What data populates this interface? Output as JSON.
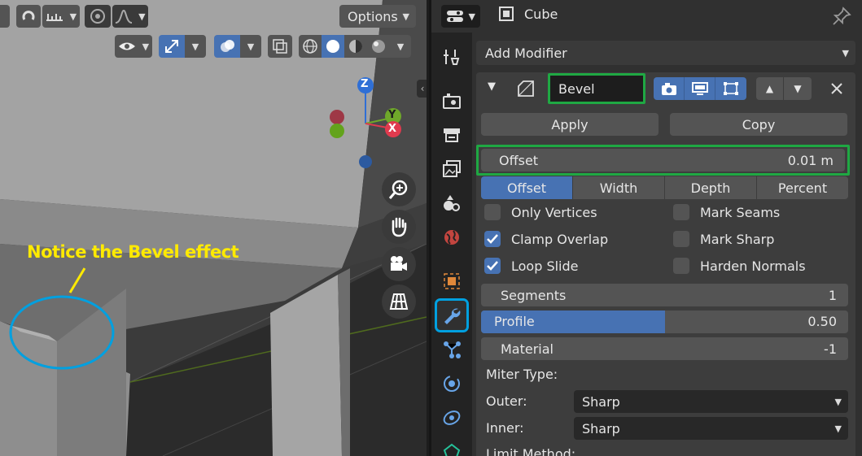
{
  "viewport": {
    "header": {
      "options_label": "Options"
    },
    "annotation": "Notice the Bevel effect",
    "gizmo": {
      "z": "Z",
      "y": "Y",
      "x": "X"
    }
  },
  "properties": {
    "object_name": "Cube",
    "add_modifier": "Add Modifier",
    "modifier": {
      "name": "Bevel",
      "apply_label": "Apply",
      "copy_label": "Copy",
      "amount": {
        "label": "Offset",
        "value": "0.01 m"
      },
      "width_type_tabs": [
        {
          "label": "Offset",
          "active": true
        },
        {
          "label": "Width",
          "active": false
        },
        {
          "label": "Depth",
          "active": false
        },
        {
          "label": "Percent",
          "active": false
        }
      ],
      "options": {
        "only_vertices": {
          "label": "Only Vertices",
          "checked": false
        },
        "mark_seams": {
          "label": "Mark Seams",
          "checked": false
        },
        "clamp_overlap": {
          "label": "Clamp Overlap",
          "checked": true
        },
        "mark_sharp": {
          "label": "Mark Sharp",
          "checked": false
        },
        "loop_slide": {
          "label": "Loop Slide",
          "checked": true
        },
        "harden_normals": {
          "label": "Harden Normals",
          "checked": false
        }
      },
      "segments": {
        "label": "Segments",
        "value": "1"
      },
      "profile": {
        "label": "Profile",
        "value": "0.50",
        "fraction": 0.5
      },
      "material": {
        "label": "Material",
        "value": "-1"
      },
      "miter_type_label": "Miter Type:",
      "outer": {
        "label": "Outer:",
        "value": "Sharp"
      },
      "inner": {
        "label": "Inner:",
        "value": "Sharp"
      },
      "limit_method_label": "Limit Method:"
    }
  },
  "colors": {
    "accent_blue": "#4772b3",
    "highlight_green": "#1fa843",
    "highlight_cyan": "#00a0e0",
    "annotation_yellow": "#ffea00"
  }
}
